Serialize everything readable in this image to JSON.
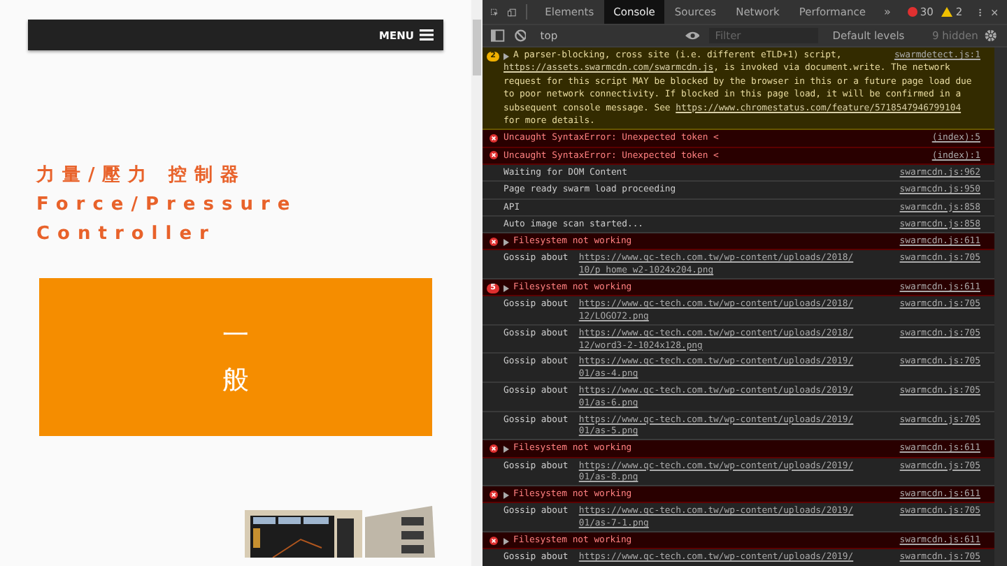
{
  "page": {
    "menu_label": "MENU",
    "title_lines": [
      "力量/壓力 控制器",
      "Force/Pressure",
      "Controller"
    ],
    "category_chars": [
      "一",
      "般"
    ],
    "product": {
      "kind": "picture"
    }
  },
  "devtools": {
    "tabs": [
      {
        "label": "Elements",
        "selected": false
      },
      {
        "label": "Console",
        "selected": true
      },
      {
        "label": "Sources",
        "selected": false
      },
      {
        "label": "Network",
        "selected": false
      },
      {
        "label": "Performance",
        "selected": false
      }
    ],
    "more_tabs": "»",
    "error_count": "30",
    "warning_count": "2",
    "context": "top",
    "filter_placeholder": "Filter",
    "levels": "Default levels",
    "hidden": "9 hidden",
    "messages": [
      {
        "kind": "warning",
        "count": "2",
        "expandable": true,
        "source": "swarmdetect.js:1",
        "parts": [
          {
            "text": "A parser-blocking, cross site (i.e. different eTLD+1) script, "
          },
          {
            "link": "https://assets.swarmcdn.com/swarmcdn.js"
          },
          {
            "text": ", is invoked via document.write. The network request for this script MAY be blocked by the browser in this or a future page load due to poor network connectivity. If blocked in this page load, it will be confirmed in a subsequent console message. See "
          },
          {
            "link": "https://www.chromestatus.com/feature/5718547946799104"
          },
          {
            "text": " for more details."
          }
        ]
      },
      {
        "kind": "error",
        "expandable": false,
        "source": "(index):5",
        "parts": [
          {
            "text": "Uncaught SyntaxError: Unexpected token <"
          }
        ]
      },
      {
        "kind": "error",
        "expandable": false,
        "source": "(index):1",
        "parts": [
          {
            "text": "Uncaught SyntaxError: Unexpected token <"
          }
        ]
      },
      {
        "kind": "log",
        "expandable": false,
        "source": "swarmcdn.js:962",
        "parts": [
          {
            "text": "Waiting for DOM Content"
          }
        ]
      },
      {
        "kind": "log",
        "expandable": false,
        "source": "swarmcdn.js:950",
        "parts": [
          {
            "text": "Page ready swarm load proceeding"
          }
        ]
      },
      {
        "kind": "log",
        "expandable": false,
        "source": "swarmcdn.js:858",
        "parts": [
          {
            "text": "API"
          }
        ]
      },
      {
        "kind": "log",
        "expandable": false,
        "source": "swarmcdn.js:858",
        "parts": [
          {
            "text": "Auto image scan started..."
          }
        ]
      },
      {
        "kind": "error",
        "expandable": true,
        "source": "swarmcdn.js:611",
        "parts": [
          {
            "text": "Filesystem not working"
          }
        ]
      },
      {
        "kind": "log",
        "expandable": false,
        "source": "swarmcdn.js:705",
        "parts": [
          {
            "text": "Gossip about  "
          },
          {
            "link": "https://www.qc-tech.com.tw/wp-content/uploads/2018/10/p_home_w2-1024x204.png"
          }
        ]
      },
      {
        "kind": "error",
        "count": "5",
        "expandable": true,
        "source": "swarmcdn.js:611",
        "parts": [
          {
            "text": "Filesystem not working"
          }
        ]
      },
      {
        "kind": "log",
        "expandable": false,
        "source": "swarmcdn.js:705",
        "parts": [
          {
            "text": "Gossip about  "
          },
          {
            "link": "https://www.qc-tech.com.tw/wp-content/uploads/2018/12/LOGO72.png"
          }
        ]
      },
      {
        "kind": "log",
        "expandable": false,
        "source": "swarmcdn.js:705",
        "parts": [
          {
            "text": "Gossip about  "
          },
          {
            "link": "https://www.qc-tech.com.tw/wp-content/uploads/2018/12/word3-2-1024x128.png"
          }
        ]
      },
      {
        "kind": "log",
        "expandable": false,
        "source": "swarmcdn.js:705",
        "parts": [
          {
            "text": "Gossip about  "
          },
          {
            "link": "https://www.qc-tech.com.tw/wp-content/uploads/2019/01/as-4.png"
          }
        ]
      },
      {
        "kind": "log",
        "expandable": false,
        "source": "swarmcdn.js:705",
        "parts": [
          {
            "text": "Gossip about  "
          },
          {
            "link": "https://www.qc-tech.com.tw/wp-content/uploads/2019/01/as-6.png"
          }
        ]
      },
      {
        "kind": "log",
        "expandable": false,
        "source": "swarmcdn.js:705",
        "parts": [
          {
            "text": "Gossip about  "
          },
          {
            "link": "https://www.qc-tech.com.tw/wp-content/uploads/2019/01/as-5.png"
          }
        ]
      },
      {
        "kind": "error",
        "expandable": true,
        "source": "swarmcdn.js:611",
        "parts": [
          {
            "text": "Filesystem not working"
          }
        ]
      },
      {
        "kind": "log",
        "expandable": false,
        "source": "swarmcdn.js:705",
        "parts": [
          {
            "text": "Gossip about  "
          },
          {
            "link": "https://www.qc-tech.com.tw/wp-content/uploads/2019/01/as-8.png"
          }
        ]
      },
      {
        "kind": "error",
        "expandable": true,
        "source": "swarmcdn.js:611",
        "parts": [
          {
            "text": "Filesystem not working"
          }
        ]
      },
      {
        "kind": "log",
        "expandable": false,
        "source": "swarmcdn.js:705",
        "parts": [
          {
            "text": "Gossip about  "
          },
          {
            "link": "https://www.qc-tech.com.tw/wp-content/uploads/2019/01/as-7-1.png"
          }
        ]
      },
      {
        "kind": "error",
        "expandable": true,
        "source": "swarmcdn.js:611",
        "parts": [
          {
            "text": "Filesystem not working"
          }
        ]
      },
      {
        "kind": "log",
        "expandable": false,
        "source": "swarmcdn.js:705",
        "parts": [
          {
            "text": "Gossip about  "
          },
          {
            "link": "https://www.qc-tech.com.tw/wp-content/uploads/2019/"
          }
        ]
      }
    ]
  }
}
